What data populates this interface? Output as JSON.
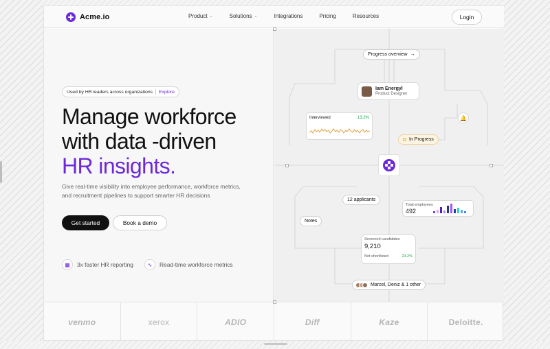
{
  "nav": {
    "brand": "Acme.io",
    "items": [
      {
        "label": "Product",
        "dropdown": true
      },
      {
        "label": "Solutions",
        "dropdown": true
      },
      {
        "label": "Integrations",
        "dropdown": false
      },
      {
        "label": "Pricing",
        "dropdown": false
      },
      {
        "label": "Resources",
        "dropdown": false
      }
    ],
    "login": "Login"
  },
  "hero": {
    "pill_text": "Used by HR leaders across organizations",
    "pill_link": "Explore",
    "title_line1": "Manage workforce",
    "title_line2": "with data -driven",
    "title_accent": "HR insights.",
    "subtitle": "Give real-time visibility into employee performance, workforce metrics, and recruitment pipelines to support smarter HR decisions",
    "cta_primary": "Get started",
    "cta_secondary": "Book a demo",
    "features": [
      {
        "icon": "grid-icon",
        "label": "3x faster HR reporting"
      },
      {
        "icon": "pulse-icon",
        "label": "Read-time workforce metrics"
      }
    ]
  },
  "diagram": {
    "progress_overview": "Progress overview",
    "profile": {
      "name": "Iam Energyl",
      "role": "Product Designer"
    },
    "interviewed": {
      "label": "Interviewed",
      "change": "13.2%"
    },
    "status": "In Progress",
    "applicants": "12 applicants",
    "notes": "Notes",
    "total_employees": {
      "label": "Total employees",
      "value": "492"
    },
    "screened": {
      "label": "Screened candidates",
      "value": "9,210",
      "sub_label": "Not shortlisted",
      "sub_value": "23.2%"
    },
    "team": "Marcel, Deniz & 1 other"
  },
  "logos": [
    "venmo",
    "xerox",
    "ADIO",
    "Diff",
    "Kaze",
    "Deloitte."
  ],
  "colors": {
    "accent": "#6d28d9",
    "positive": "#16a34a",
    "status_bg": "#fdf3e1",
    "status_dot": "#e8a33d"
  }
}
